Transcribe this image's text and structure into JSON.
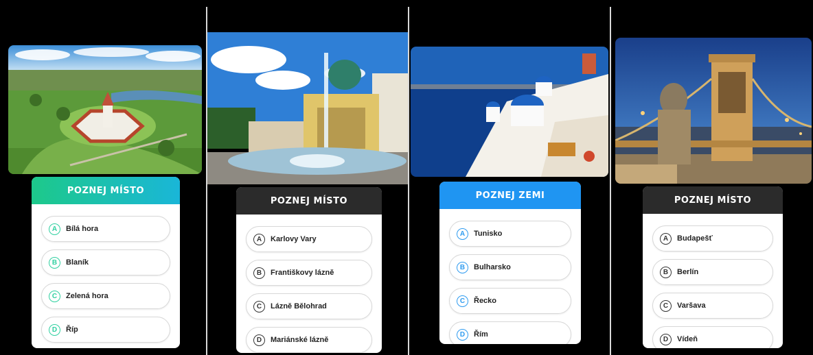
{
  "panels": [
    {
      "title": "POZNEJ MÍSTO",
      "header_style": "gradient-green",
      "badge_color": "#2fd0a0",
      "photo_subject": "aerial view of pilgrimage church",
      "options": [
        {
          "letter": "A",
          "label": "Bílá hora"
        },
        {
          "letter": "B",
          "label": "Blaník"
        },
        {
          "letter": "C",
          "label": "Zelená hora"
        },
        {
          "letter": "D",
          "label": "Říp"
        }
      ]
    },
    {
      "title": "POZNEJ MÍSTO",
      "header_style": "dark",
      "badge_color": "#333333",
      "photo_subject": "colonnade with fountain",
      "options": [
        {
          "letter": "A",
          "label": "Karlovy Vary"
        },
        {
          "letter": "B",
          "label": "Františkovy lázně"
        },
        {
          "letter": "C",
          "label": "Lázně Bělohrad"
        },
        {
          "letter": "D",
          "label": "Mariánské lázně"
        }
      ]
    },
    {
      "title": "POZNEJ ZEMI",
      "header_style": "blue",
      "badge_color": "#2e9bf0",
      "photo_subject": "white houses with blue domes by the sea",
      "options": [
        {
          "letter": "A",
          "label": "Tunisko"
        },
        {
          "letter": "B",
          "label": "Bulharsko"
        },
        {
          "letter": "C",
          "label": "Řecko"
        },
        {
          "letter": "D",
          "label": "Řím"
        }
      ]
    },
    {
      "title": "POZNEJ MÍSTO",
      "header_style": "dark",
      "badge_color": "#333333",
      "photo_subject": "chain bridge with lion statue at dusk",
      "options": [
        {
          "letter": "A",
          "label": "Budapešť"
        },
        {
          "letter": "B",
          "label": "Berlín"
        },
        {
          "letter": "C",
          "label": "Varšava"
        },
        {
          "letter": "D",
          "label": "Vídeň"
        }
      ]
    }
  ],
  "colors": {
    "green_gradient_start": "#1dc98a",
    "green_gradient_end": "#1ab6d8",
    "dark_header": "#2b2b2b",
    "blue_header": "#1f95f2"
  }
}
